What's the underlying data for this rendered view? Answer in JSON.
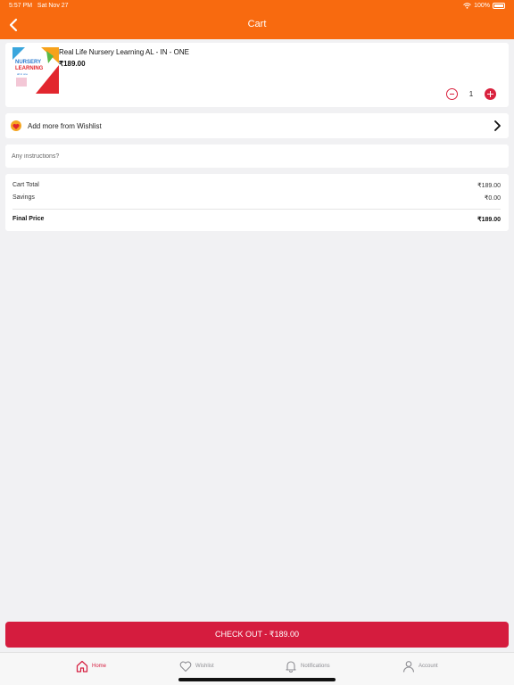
{
  "status_bar": {
    "time": "5:57 PM",
    "date": "Sat Nov 27",
    "battery": "100%"
  },
  "nav": {
    "title": "Cart"
  },
  "cart_item": {
    "name": "Real Life Nursery Learning AL - IN - ONE",
    "price": "₹189.00",
    "quantity": "1",
    "cover_title_top": "NURSERY",
    "cover_title_bottom": "LEARNING",
    "cover_sub": "all in one"
  },
  "wishlist_link": {
    "label": "Add more from Wishlist"
  },
  "instructions": {
    "placeholder": "Any instructions?"
  },
  "summary": {
    "cart_total_label": "Cart Total",
    "cart_total_value": "₹189.00",
    "savings_label": "Savings",
    "savings_value": "₹0.00",
    "final_label": "Final Price",
    "final_value": "₹189.00"
  },
  "checkout": {
    "label": "CHECK OUT - ₹189.00"
  },
  "tabs": [
    {
      "label": "Home",
      "icon": "home-icon",
      "active": true
    },
    {
      "label": "Wishlist",
      "icon": "heart-icon",
      "active": false
    },
    {
      "label": "Notifications",
      "icon": "bell-icon",
      "active": false
    },
    {
      "label": "Account",
      "icon": "person-icon",
      "active": false
    }
  ],
  "colors": {
    "header": "#f86a0f",
    "accent": "#d51c3e",
    "background": "#f1f1f3"
  }
}
